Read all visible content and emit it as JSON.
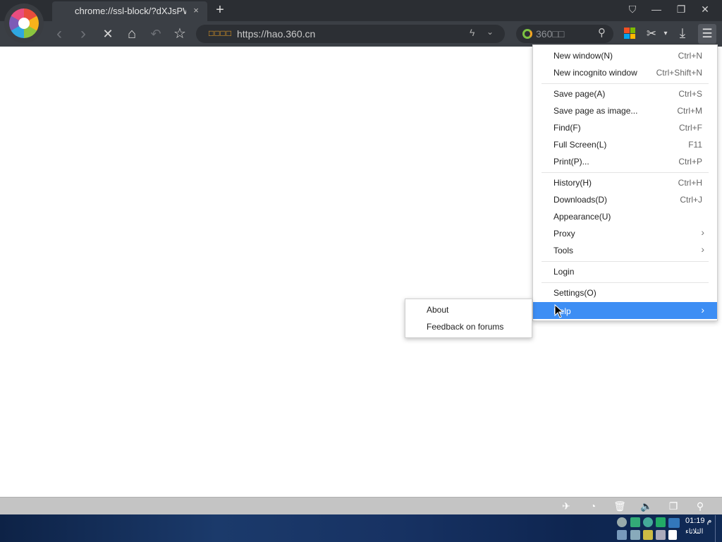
{
  "tab": {
    "title": "chrome://ssl-block/?dXJsPW",
    "close": "×",
    "new_tab": "+"
  },
  "window": {
    "skin": "⛉",
    "minimize": "—",
    "restore": "❐",
    "close": "✕"
  },
  "toolbar": {
    "back": "‹",
    "forward": "›",
    "stop": "✕",
    "home": "⌂",
    "undo": "↶",
    "star": "☆",
    "url_prefix": "□□□□",
    "url": "https://hao.360.cn",
    "bolt": "ϟ",
    "url_dropdown": "⌄",
    "search_text": "360□□",
    "search_mag": "⚲",
    "scissors": "✂",
    "scissors_dropdown": "▾",
    "download": "⤓",
    "menu": "☰"
  },
  "menu": {
    "items": [
      {
        "label": "New window(N)",
        "shortcut": "Ctrl+N"
      },
      {
        "label": "New incognito window",
        "shortcut": "Ctrl+Shift+N"
      },
      {
        "label": "Save page(A)",
        "shortcut": "Ctrl+S"
      },
      {
        "label": "Save page as image...",
        "shortcut": "Ctrl+M"
      },
      {
        "label": "Find(F)",
        "shortcut": "Ctrl+F"
      },
      {
        "label": "Full Screen(L)",
        "shortcut": "F11"
      },
      {
        "label": "Print(P)...",
        "shortcut": "Ctrl+P"
      },
      {
        "label": "History(H)",
        "shortcut": "Ctrl+H"
      },
      {
        "label": "Downloads(D)",
        "shortcut": "Ctrl+J"
      },
      {
        "label": "Appearance(U)",
        "shortcut": ""
      },
      {
        "label": "Proxy",
        "shortcut": ""
      },
      {
        "label": "Tools",
        "shortcut": ""
      },
      {
        "label": "Login",
        "shortcut": ""
      },
      {
        "label": "Settings(O)",
        "shortcut": ""
      },
      {
        "label": "Help",
        "shortcut": ""
      }
    ],
    "submenu_arrow": "›"
  },
  "help_submenu": {
    "items": [
      {
        "label": "About"
      },
      {
        "label": "Feedback on forums"
      }
    ]
  },
  "statusbar": {
    "icons": [
      "✈",
      "◔",
      "🗑",
      "🔈",
      "❐",
      "⚲"
    ]
  },
  "taskbar": {
    "time": "01:19 م",
    "date": "الثلاثاء"
  }
}
